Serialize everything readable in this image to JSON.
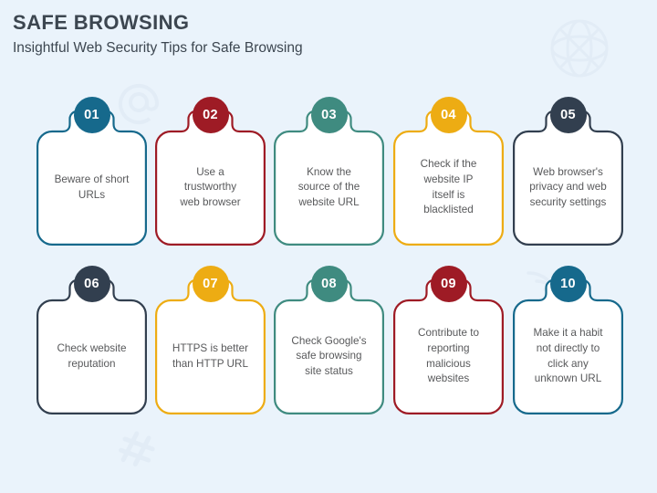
{
  "header": {
    "title": "SAFE BROWSING",
    "subtitle": "Insightful Web Security Tips for Safe Browsing"
  },
  "theme": {
    "background": "#eaf3fb",
    "card_fill": "#ffffff",
    "text_color": "#58595b",
    "heading_color": "#3c4650",
    "watermark_color": "#e2ecf6"
  },
  "watermarks": [
    {
      "name": "globe-watermark",
      "icon": "globe-icon"
    },
    {
      "name": "at-sign-watermark",
      "icon": "at-sign-icon"
    },
    {
      "name": "hashtag-watermark",
      "icon": "hashtag-icon"
    },
    {
      "name": "wifi-watermark",
      "icon": "wifi-icon"
    }
  ],
  "cards": [
    {
      "number": "01",
      "text": "Beware of short\nURLs",
      "color": "#16698c"
    },
    {
      "number": "02",
      "text": "Use a\ntrustworthy\nweb browser",
      "color": "#9e1b25"
    },
    {
      "number": "03",
      "text": "Know the\nsource of the\nwebsite URL",
      "color": "#3f8b80"
    },
    {
      "number": "04",
      "text": "Check if the\nwebsite IP\nitself is\nblacklisted",
      "color": "#edac13"
    },
    {
      "number": "05",
      "text": "Web browser's\nprivacy and web\nsecurity settings",
      "color": "#323f4f"
    },
    {
      "number": "06",
      "text": "Check website\nreputation",
      "color": "#323f4f"
    },
    {
      "number": "07",
      "text": "HTTPS is better\nthan HTTP URL",
      "color": "#edac13"
    },
    {
      "number": "08",
      "text": "Check Google's\nsafe browsing\nsite status",
      "color": "#3f8b80"
    },
    {
      "number": "09",
      "text": "Contribute to\nreporting\nmalicious\nwebsites",
      "color": "#9e1b25"
    },
    {
      "number": "10",
      "text": "Make it a habit\nnot directly to\nclick any\nunknown URL",
      "color": "#16698c"
    }
  ]
}
